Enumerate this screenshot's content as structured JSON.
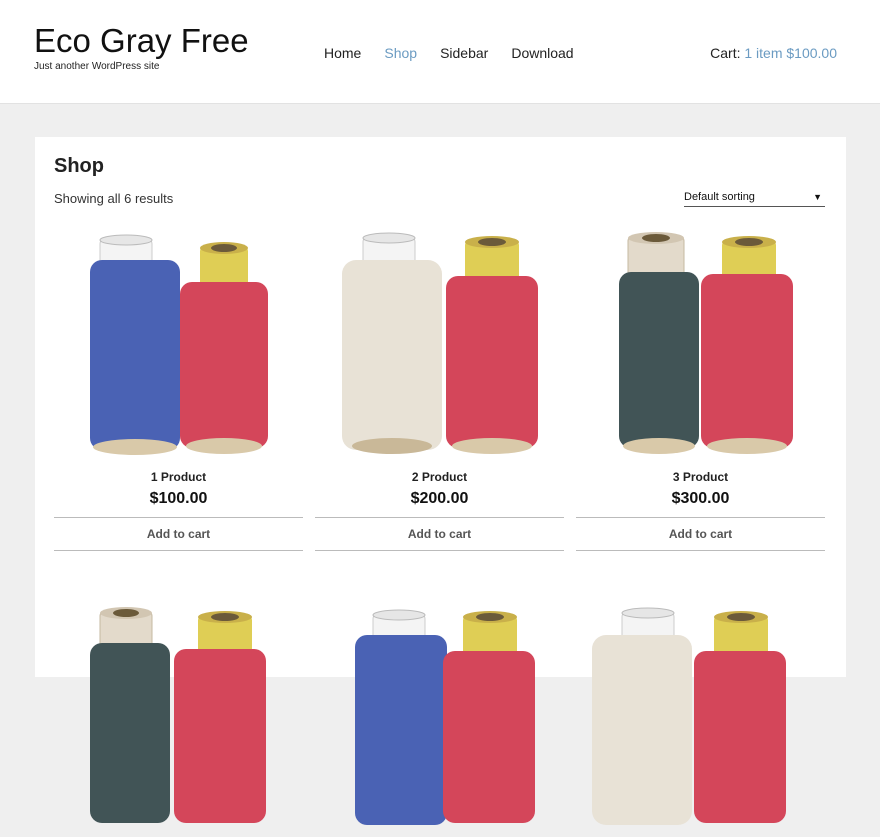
{
  "site": {
    "title": "Eco Gray Free",
    "tagline": "Just another WordPress site"
  },
  "nav": {
    "items": [
      {
        "label": "Home"
      },
      {
        "label": "Shop"
      },
      {
        "label": "Sidebar"
      },
      {
        "label": "Download"
      }
    ],
    "active": "Shop"
  },
  "cart": {
    "label": "Cart:",
    "summary": "1 item $100.00"
  },
  "shop": {
    "title": "Shop",
    "result_count": "Showing all 6 results",
    "sorting": "Default sorting"
  },
  "products": [
    {
      "name": "1 Product",
      "price": "$100.00",
      "button": "Add to cart"
    },
    {
      "name": "2 Product",
      "price": "$200.00",
      "button": "Add to cart"
    },
    {
      "name": "3 Product",
      "price": "$300.00",
      "button": "Add to cart"
    }
  ],
  "colors": {
    "accent": "#6b9bc2",
    "page_bg": "#efefef",
    "card_bg": "#ffffff",
    "spool_blue": "#4a62b4",
    "spool_red": "#d4465a",
    "spool_cream": "#e8e2d6",
    "spool_teal": "#415456",
    "spool_yellow_cap": "#dfce55"
  }
}
